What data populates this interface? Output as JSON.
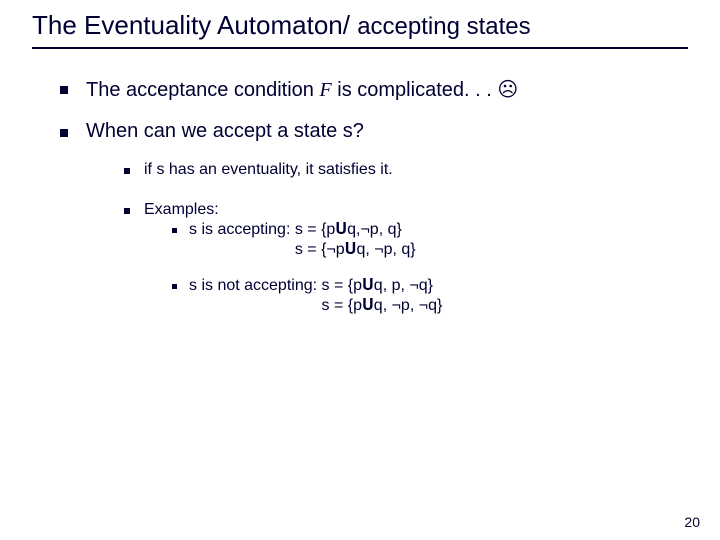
{
  "title": {
    "part1": "The Eventuality Automaton/ ",
    "part2": "accepting states"
  },
  "line1": {
    "pre": "The acceptance condition ",
    "f": "F",
    "post": " is complicated. . . ",
    "frown": "☹"
  },
  "line2": "When can we accept a state s?",
  "sub1": "if s has an eventuality, it satisfies it.",
  "examples_label": "Examples:",
  "ex_accepting": {
    "lead": "s is accepting: ",
    "s1": "s = {p𝐔q,¬p, q}",
    "s2": "s = {¬p𝐔q, ¬p, q}"
  },
  "ex_not_accepting": {
    "lead": "s is not accepting: ",
    "s1": "s = {p𝐔q, p, ¬q}",
    "s2": "s = {p𝐔q, ¬p, ¬q}"
  },
  "page_number": "20"
}
